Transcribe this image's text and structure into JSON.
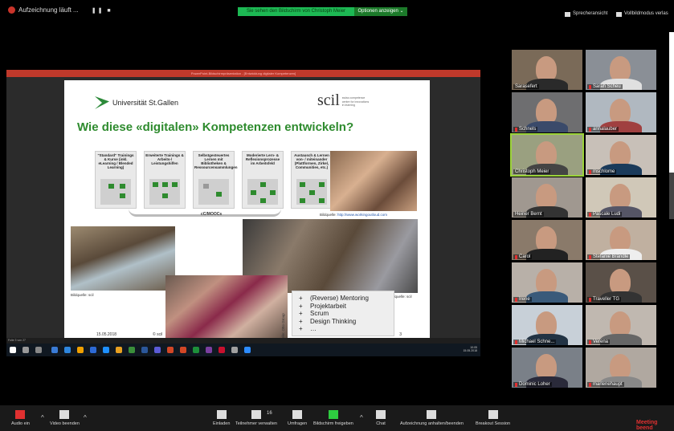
{
  "topbar": {
    "recording": "Aufzeichnung läuft ...",
    "recording_controls": "❚❚ ■",
    "share_banner": "Sie sehen den Bildschirm von Christoph Meier",
    "options_button": "Optionen anzeigen ⌄",
    "speaker_view": "Sprecheransicht",
    "fullscreen": "Vollbildmodus verlas"
  },
  "ppt": {
    "window_title": "PowerPoint-Bildschirmpräsentation - [Entwicklung digitaler Kompetenzen]",
    "status": "Folie 3 von 27",
    "clock_time": "10:05",
    "clock_date": "15.05.2018"
  },
  "slide": {
    "hsg_name": "Universität St.Gallen",
    "scil_word": "scil",
    "scil_sub": "swiss competence centre for innovations in learning",
    "heading": "Wie diese «digitalen» Kompetenzen entwickeln?",
    "boxes": [
      "\"Standard\" Trainings & Kurse (inkl. eLearning / Blended Learning)",
      "Erweiterte Trainings & Arbeits-/ Leistungshilfen",
      "Selbstgesteuertes Lernen mit Bibliotheken & Ressourcensammlungen",
      "Moderierte Lern- & Reflexionsprozesse im Arbeitsfeld",
      "Austausch & Lernen von- / miteinander (Plattformen, Zirkel, Communities, etc.)"
    ],
    "mooc_label": "cC/MOOCs",
    "caption_top_prefix": "Bildquelle:",
    "caption_top_link": "http://www.workingoutloud.com",
    "caption_right": "Bildquelle: scil",
    "caption_left": "Bildquelle: scil",
    "quelle": "Quelle: Otto Group",
    "list": [
      "(Reverse) Mentoring",
      "Projektarbeit",
      "Scrum",
      "Design Thinking",
      "…"
    ],
    "list_bullet": "+",
    "footer_date": "15.05.2018",
    "footer_copy": "© scil",
    "footer_page": "3"
  },
  "participants": [
    {
      "name": "Sarasefert"
    },
    {
      "name": "Sarah Scheu"
    },
    {
      "name": "Schnels"
    },
    {
      "name": "annalauber"
    },
    {
      "name": "Christoph Meier"
    },
    {
      "name": "mschlome"
    },
    {
      "name": "Heiner Bernt"
    },
    {
      "name": "Pascale Ludi"
    },
    {
      "name": "Carol"
    },
    {
      "name": "Stefanie Brändle"
    },
    {
      "name": "Irene"
    },
    {
      "name": "Traveller TG"
    },
    {
      "name": "Michael Schne..."
    },
    {
      "name": "Verena"
    },
    {
      "name": "Dominic Loher"
    },
    {
      "name": "marlenehaupt"
    }
  ],
  "bottombar": {
    "audio": "Audio ein",
    "video": "Video beenden",
    "invite": "Einladen",
    "participants": "Teilnehmer verwalten",
    "participants_count": "16",
    "polls": "Umfragen",
    "share": "Bildschirm freigeben",
    "chat": "Chat",
    "recording": "Aufzeichnung anhalten/beenden",
    "breakout": "Breakout Session",
    "end": "Meeting beend"
  },
  "colors": {
    "accent_green": "#1db954",
    "slide_heading": "#2e8b2e",
    "end_red": "#e03030"
  }
}
